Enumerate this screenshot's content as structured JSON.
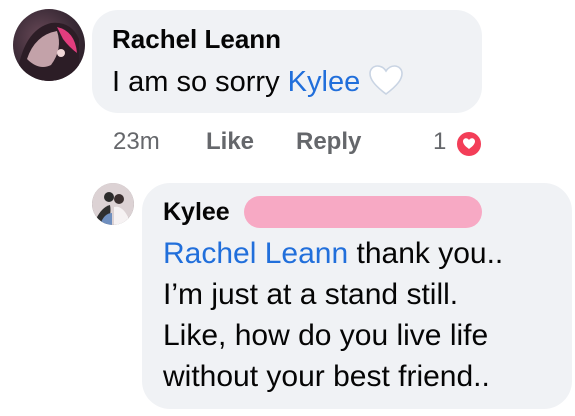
{
  "comment": {
    "author": "Rachel Leann",
    "text_prefix": "I am so sorry ",
    "mention": "Kylee",
    "emoji": "white-heart-icon",
    "time": "23m",
    "like_label": "Like",
    "reply_label": "Reply",
    "reaction_count": "1",
    "reaction_icon": "love-reaction-icon"
  },
  "reply": {
    "author": "Kylee",
    "mention": "Rachel Leann",
    "line1_rest": " thank you..",
    "line2": "I’m just at a stand still.",
    "line3": "Like, how do you live life",
    "line4": "without your best friend.."
  },
  "colors": {
    "bubble": "#f0f2f5",
    "mention": "#216fdb",
    "meta": "#65676b",
    "redaction": "#f7a9c4",
    "love_reaction": "#f33e58"
  }
}
